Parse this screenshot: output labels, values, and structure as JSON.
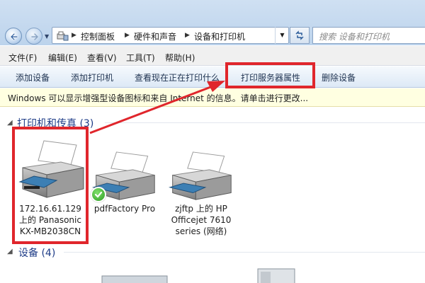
{
  "address": {
    "breadcrumbs": [
      "控制面板",
      "硬件和声音",
      "设备和打印机"
    ],
    "search_placeholder": "搜索 设备和打印机"
  },
  "menu": [
    "文件(F)",
    "编辑(E)",
    "查看(V)",
    "工具(T)",
    "帮助(H)"
  ],
  "commands": [
    "添加设备",
    "添加打印机",
    "查看现在正在打印什么",
    "打印服务器属性",
    "删除设备"
  ],
  "info_bar": "Windows 可以显示增强型设备图标和来自 Internet 的信息。请单击进行更改...",
  "printers_group": {
    "title": "打印机和传真 (3)",
    "items": [
      {
        "lines": [
          "172.16.61.129",
          "上的 Panasonic",
          "KX-MB2038CN"
        ]
      },
      {
        "lines": [
          "pdfFactory Pro"
        ],
        "default": true
      },
      {
        "lines": [
          "zjftp 上的 HP",
          "Officejet 7610",
          "series (网络)"
        ]
      }
    ]
  },
  "devices_group": {
    "title": "设备 (4)"
  },
  "colors": {
    "accent_red": "#e0262c",
    "group_header": "#1e3c87",
    "info_bg": "#ffffe1"
  },
  "icons": [
    "back-arrow-icon",
    "forward-arrow-icon",
    "devices-folder-icon",
    "refresh-icon",
    "search-icon",
    "printer-icon",
    "default-check-icon"
  ]
}
